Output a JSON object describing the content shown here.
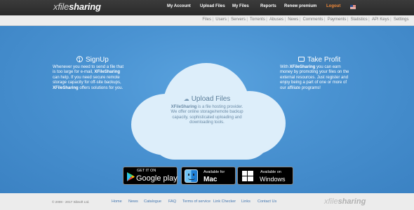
{
  "header": {
    "logo_x": "x",
    "logo_main": "file",
    "logo_bold": "sharing",
    "nav": [
      "My Account",
      "Upload Files",
      "My Files",
      "Reports",
      "Renew premium",
      "Logout"
    ]
  },
  "subnav": [
    "Files",
    "Users",
    "Servers",
    "Torrents",
    "Abuses",
    "News",
    "Comments",
    "Payments",
    "Statistics",
    "API Keys",
    "Settings"
  ],
  "signup": {
    "title": "SignUp",
    "line1": "Whenever you need to send a file that",
    "line2a": "is too large for e-mail, ",
    "line2b": "XFileSharing",
    "line3": "can help. If you need secure remote",
    "line4": "storage capacity for off-site backups,",
    "line5a": "XFileSharing",
    "line5b": " offers solutions for you."
  },
  "upload": {
    "title": "Upload Files",
    "line1a": "XFileSharing",
    "line1b": " is a file hosting provider.",
    "line2": "We offer online storage/remote backup",
    "line3": "capacity, sophisticated uploading and",
    "line4": "downloading tools."
  },
  "profit": {
    "title": "Take Profit",
    "line1a": "With ",
    "line1b": "XFileSharing",
    "line1c": " you can earn",
    "line2": "money by promoting your files on the",
    "line3": "external resources. Just register and",
    "line4": "enjoy being a part of one or more of",
    "line5": "our affiliate programs!"
  },
  "badges": {
    "gp_small": "GET IT ON",
    "gp_big": "Google play",
    "mac_small": "Available for",
    "mac_big": "Mac",
    "win_small": "Available on",
    "win_big": "Windows"
  },
  "footer": {
    "copyright": "© 2008 - 2017 Sibsoft Ltd.",
    "links": [
      "Home",
      "News",
      "Catalogue",
      "FAQ",
      "Terms of service",
      "Link Checker",
      "Links",
      "Contact Us"
    ],
    "logo_main": "xfile",
    "logo_bold": "sharing"
  },
  "colors": {
    "topbar": "#2f2f2f",
    "logout": "#f28a3a",
    "hero": "#4a93d2",
    "cloud": "#ddeefa",
    "footer_link": "#4377b0"
  }
}
